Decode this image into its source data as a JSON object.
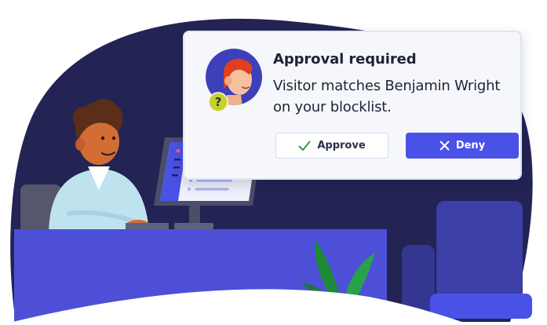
{
  "notification": {
    "title": "Approval required",
    "message": "Visitor matches Benjamin Wright on your blocklist.",
    "approve_label": "Approve",
    "deny_label": "Deny",
    "approve_icon": "checkmark-icon",
    "deny_icon": "x-icon",
    "avatar_badge": "?"
  },
  "colors": {
    "accent": "#4a51e6",
    "approve_check": "#2e9b4b",
    "background_blob": "#232354",
    "desk": "#4d50d6",
    "badge": "#c6d22c"
  }
}
